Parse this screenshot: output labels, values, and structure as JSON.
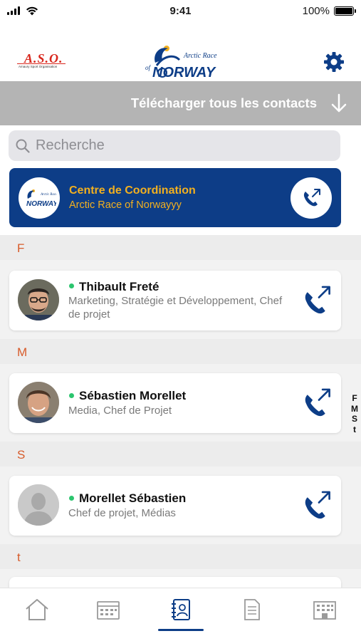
{
  "status_bar": {
    "time": "9:41",
    "battery": "100%"
  },
  "header": {
    "left_logo_text": "A.S.O.",
    "left_logo_subtext": "Amaury Sport Organisation",
    "center_logo_line1": "Arctic Race",
    "center_logo_line2": "of",
    "center_logo_line3": "NORWAY"
  },
  "download_bar": {
    "label": "Télécharger tous les contacts"
  },
  "search": {
    "placeholder": "Recherche"
  },
  "coordination": {
    "title": "Centre de Coordination",
    "subtitle": "Arctic Race of Norwayyy"
  },
  "sections": [
    {
      "letter": "F",
      "contacts": [
        {
          "name": "Thibault Freté",
          "role": "Marketing, Stratégie et Développement, Chef de projet",
          "online": true
        }
      ]
    },
    {
      "letter": "M",
      "contacts": [
        {
          "name": "Sébastien Morellet",
          "role": "Media, Chef de Projet",
          "online": true
        }
      ]
    },
    {
      "letter": "S",
      "contacts": [
        {
          "name": "Morellet Sébastien",
          "role": "Chef de projet, Médias",
          "online": true
        }
      ]
    },
    {
      "letter": "t",
      "contacts": []
    }
  ],
  "index_letters": [
    "F",
    "M",
    "S",
    "t"
  ],
  "tabs": [
    {
      "icon": "home-icon",
      "active": false
    },
    {
      "icon": "calendar-icon",
      "active": false
    },
    {
      "icon": "contacts-icon",
      "active": true
    },
    {
      "icon": "document-icon",
      "active": false
    },
    {
      "icon": "building-icon",
      "active": false
    }
  ],
  "colors": {
    "brand_blue": "#0d3d87",
    "accent_gold": "#f2b01f",
    "section_letter": "#d75b2a",
    "online_green": "#2bc56e",
    "download_bar": "#b4b4b4"
  }
}
